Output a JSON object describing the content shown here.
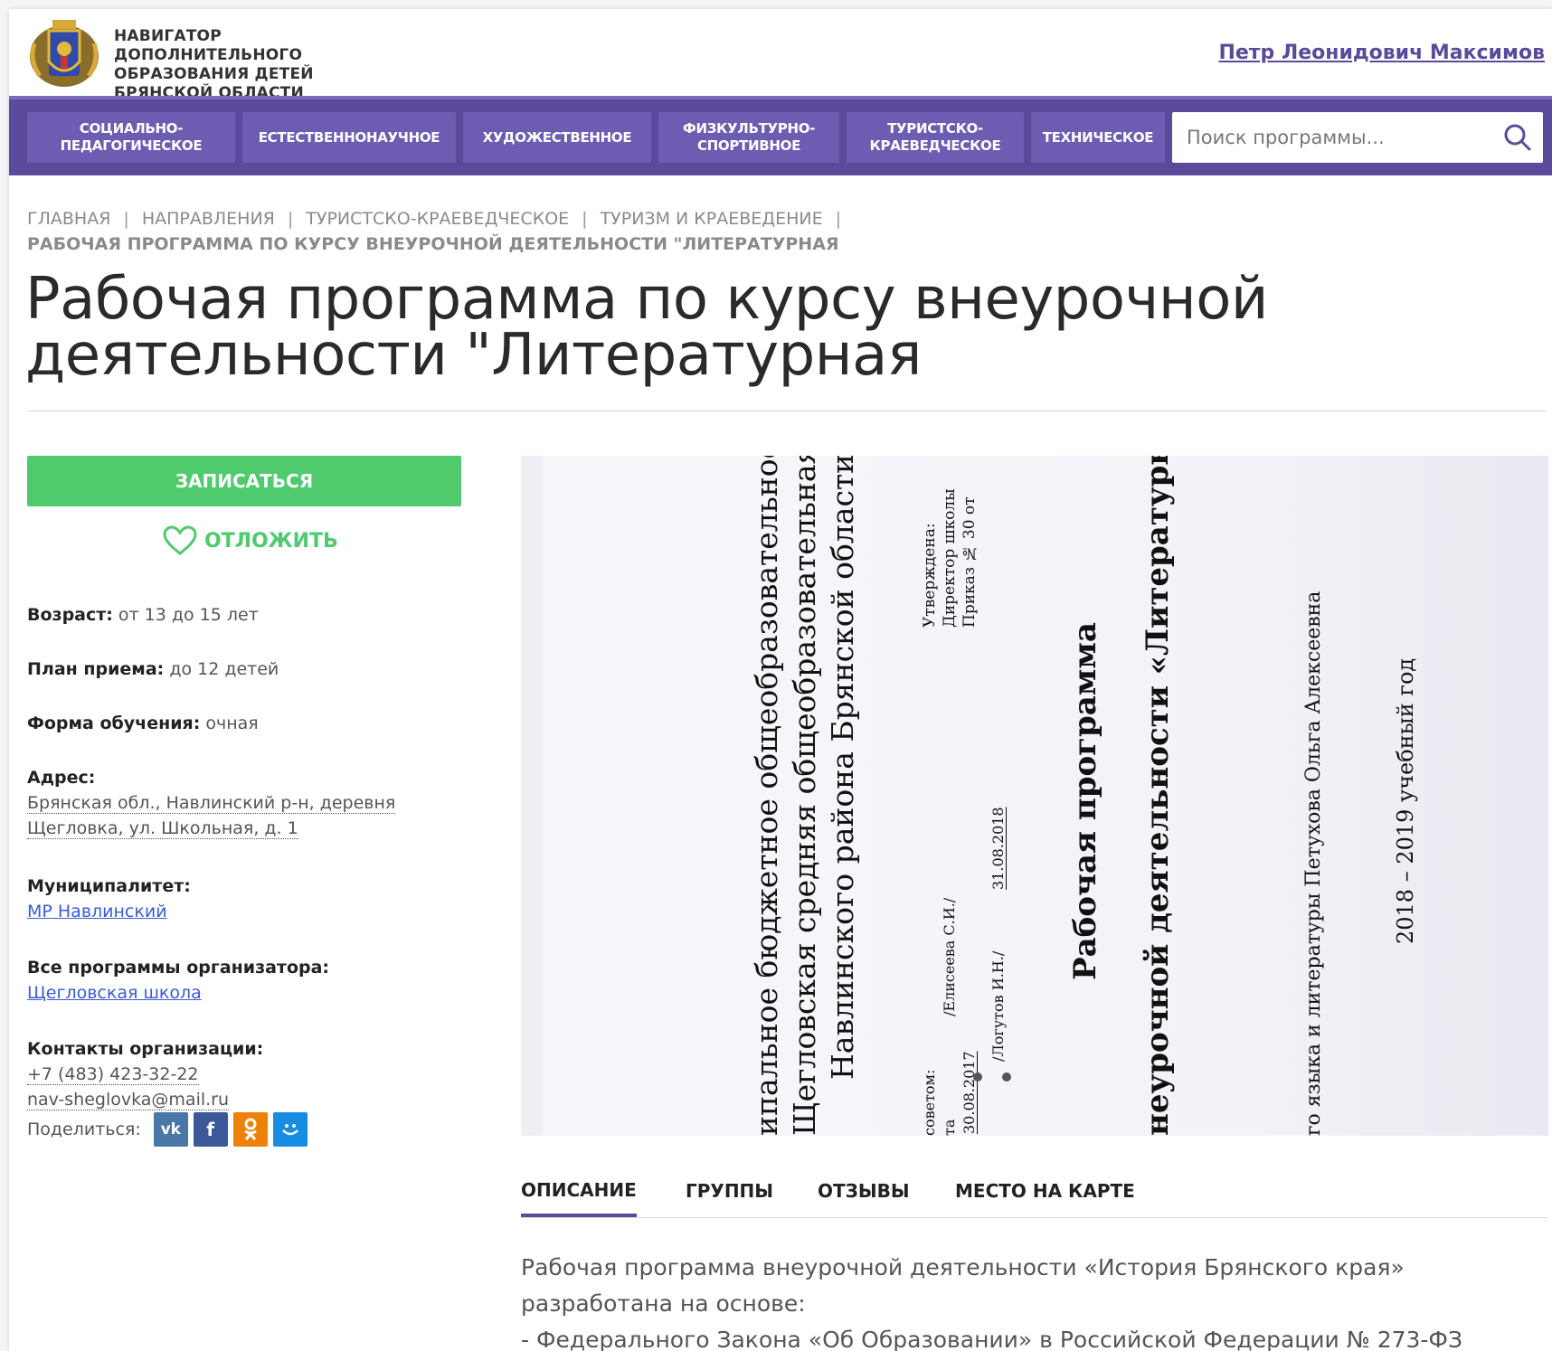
{
  "header": {
    "site_title": "Навигатор дополнительного образования детей Брянской области",
    "user_name": "Петр Леонидович Максимов"
  },
  "nav": {
    "items": [
      {
        "label": "Социально-педагогическое"
      },
      {
        "label": "Естественнонаучное"
      },
      {
        "label": "Художественное"
      },
      {
        "label": "Физкультурно-спортивное"
      },
      {
        "label": "Туристско-краеведческое"
      },
      {
        "label": "Техническое"
      }
    ],
    "search_placeholder": "Поиск программы..."
  },
  "breadcrumb": {
    "items": [
      "Главная",
      "Направления",
      "Туристско-краеведческое",
      "Туризм и краеведение"
    ],
    "current": "Рабочая программа по курсу внеурочной деятельности \"Литературная"
  },
  "page_title": "Рабочая программа по курсу внеурочной деятельности \"Литературная",
  "actions": {
    "enroll_label": "Записаться",
    "postpone_label": "Отложить"
  },
  "info": {
    "age_label": "Возраст:",
    "age_value": "от 13 до 15 лет",
    "plan_label": "План приема:",
    "plan_value": "до 12 детей",
    "form_label": "Форма обучения:",
    "form_value": "очная",
    "address_label": "Адрес:",
    "address_line1": "Брянская обл., Навлинский р-н, деревня",
    "address_line2": "Щегловка, ул. Школьная, д. 1",
    "municipality_label": "Муниципалитет:",
    "municipality_value": "МР Навлинский",
    "organizer_label": "Все программы организатора:",
    "organizer_value": "Щегловская школа",
    "contacts_label": "Контакты организации:",
    "phone": "+7 (483) 423-32-22",
    "email": "nav-sheglovka@mail.ru",
    "share_label": "Поделиться:"
  },
  "share_icons": [
    "vk-icon",
    "facebook-icon",
    "odnoklassniki-icon",
    "moimir-icon"
  ],
  "document": {
    "line1": "ипальное бюджетное общеобразовательное учр",
    "line2": "Щегловская средняя общеобразовательная шко",
    "line3": "Навлинского района Брянской области",
    "approved1": "Утверждена:",
    "approved2": "Директор школы",
    "approved3": "Приказ №  30  от",
    "council1": "советом:",
    "council2": "та",
    "council3": "30.08.2017",
    "sig1": "/Елисеева С.И./",
    "sig2": "/Логутов И.Н./",
    "sig2_date": "31.08.2018",
    "heading1": "Рабочая программа",
    "heading2": "неурочной деятельности «Литературная",
    "author": "го языка и литературы Петухова Ольга Алексеевна",
    "year": "2018 – 2019 учебный год"
  },
  "tabs": [
    {
      "label": "Описание",
      "active": true
    },
    {
      "label": "Группы"
    },
    {
      "label": "Отзывы"
    },
    {
      "label": "Место на карте"
    }
  ],
  "description": {
    "line1": "Рабочая программа внеурочной деятельности «История Брянского края»",
    "line2": "разработана на основе:",
    "line3": "- Федерального Закона «Об Образовании» в Российской Федерации № 273-ФЗ"
  },
  "colors": {
    "brand_purple": "#5b4a9c",
    "nav_item": "#6d5cb2",
    "accent_green": "#4fcb6e",
    "link_blue": "#3a5bd9"
  }
}
